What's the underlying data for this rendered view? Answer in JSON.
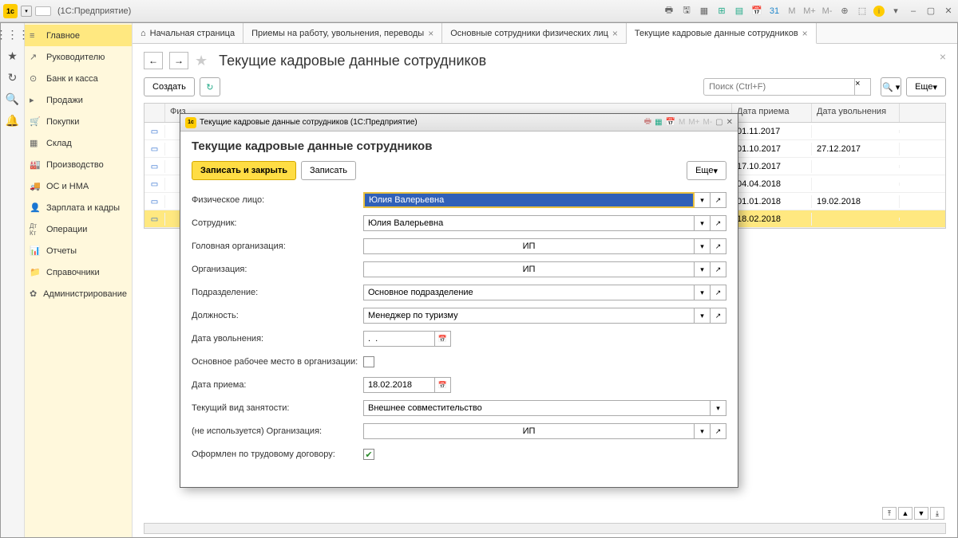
{
  "window_title": "(1С:Предприятие)",
  "top_icons": [
    "M",
    "M+",
    "M-"
  ],
  "sidebar": {
    "items": [
      {
        "icon": "≡",
        "label": "Главное"
      },
      {
        "icon": "↗",
        "label": "Руководителю"
      },
      {
        "icon": "⊕",
        "label": "Банк и касса"
      },
      {
        "icon": "▶",
        "label": "Продажи"
      },
      {
        "icon": "🛒",
        "label": "Покупки"
      },
      {
        "icon": "▦",
        "label": "Склад"
      },
      {
        "icon": "⚙",
        "label": "Производство"
      },
      {
        "icon": "🚚",
        "label": "ОС и НМА"
      },
      {
        "icon": "👤",
        "label": "Зарплата и кадры"
      },
      {
        "icon": "Дт",
        "label": "Операции"
      },
      {
        "icon": "📊",
        "label": "Отчеты"
      },
      {
        "icon": "📁",
        "label": "Справочники"
      },
      {
        "icon": "✿",
        "label": "Администрирование"
      }
    ]
  },
  "tabs": [
    {
      "icon": "⌂",
      "label": "Начальная страница",
      "closable": false
    },
    {
      "label": "Приемы на работу, увольнения, переводы",
      "closable": true
    },
    {
      "label": "Основные сотрудники физических лиц",
      "closable": true
    },
    {
      "label": "Текущие кадровые данные сотрудников",
      "closable": true,
      "active": true
    }
  ],
  "page": {
    "title": "Текущие кадровые данные сотрудников",
    "create_btn": "Создать",
    "search_placeholder": "Поиск (Ctrl+F)",
    "more_btn": "Еще"
  },
  "table": {
    "headers": [
      "",
      "Физ",
      "Дата приема",
      "Дата увольнения"
    ],
    "rows": [
      {
        "d1": "01.11.2017",
        "d2": ""
      },
      {
        "d1": "01.10.2017",
        "d2": "27.12.2017"
      },
      {
        "d1": "17.10.2017",
        "d2": ""
      },
      {
        "d1": "04.04.2018",
        "d2": ""
      },
      {
        "d1": "01.01.2018",
        "d2": "19.02.2018"
      },
      {
        "d1": "18.02.2018",
        "d2": "",
        "sel": true
      }
    ]
  },
  "modal": {
    "titlebar": "Текущие кадровые данные сотрудников  (1С:Предприятие)",
    "title": "Текущие кадровые данные сотрудников",
    "save_close": "Записать и закрыть",
    "save": "Записать",
    "more": "Еще",
    "fields": {
      "physical_person_label": "Физическое лицо:",
      "physical_person_value": "Юлия Валерьевна",
      "employee_label": "Сотрудник:",
      "employee_value": "Юлия Валерьевна",
      "head_org_label": "Головная организация:",
      "head_org_value": "ИП",
      "org_label": "Организация:",
      "org_value": "ИП",
      "dept_label": "Подразделение:",
      "dept_value": "Основное подразделение",
      "position_label": "Должность:",
      "position_value": "Менеджер по туризму",
      "dismiss_date_label": "Дата увольнения:",
      "dismiss_date_value": ".  .",
      "main_workplace_label": "Основное рабочее место в организации:",
      "hire_date_label": "Дата приема:",
      "hire_date_value": "18.02.2018",
      "employment_type_label": "Текущий вид занятости:",
      "employment_type_value": "Внешнее совместительство",
      "unused_org_label": "(не используется) Организация:",
      "unused_org_value": "ИП",
      "contract_label": "Оформлен по трудовому договору:"
    }
  }
}
